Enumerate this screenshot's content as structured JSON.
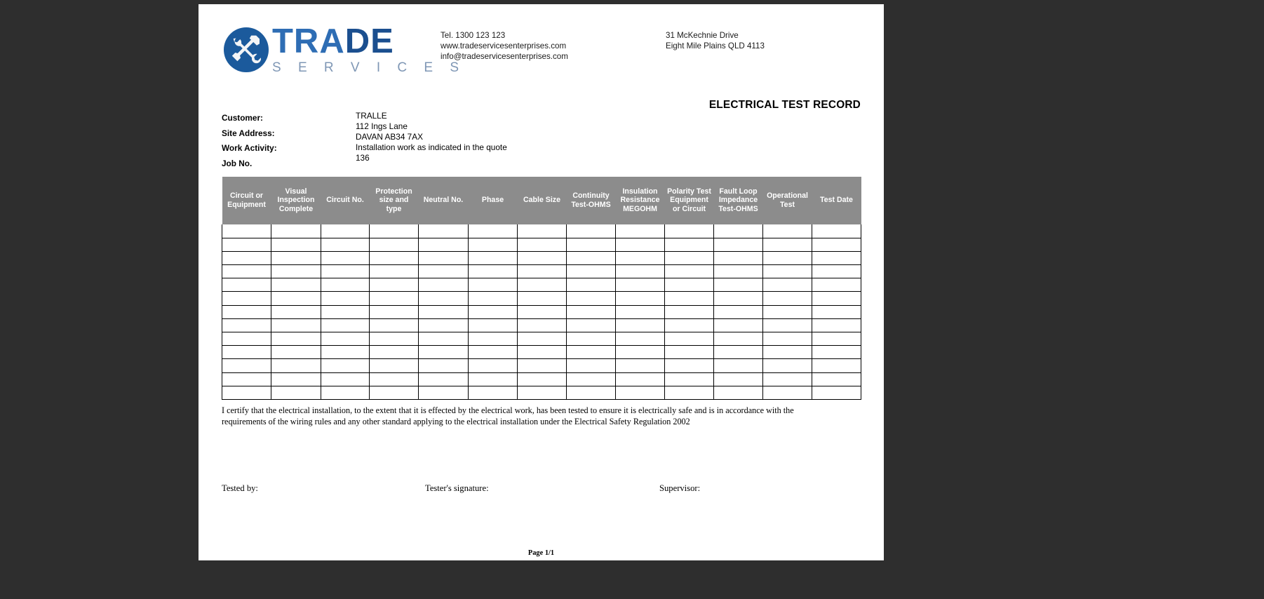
{
  "document": {
    "title": "ELECTRICAL TEST RECORD",
    "footer_page_label": "Page 1/1"
  },
  "letterhead": {
    "logo": {
      "mark_icon": "crossed-hammer-wrench-circle-icon",
      "word_main": "TRADE",
      "word_sub": "S E R V I C E S",
      "brand_blue": "#2e6db4",
      "brand_blue_dark": "#1b4f8f",
      "brand_grey_blue": "#7f97b5"
    },
    "contact": {
      "tel": "Tel. 1300 123 123",
      "website": "www.tradeservicesenterprises.com",
      "email": "info@tradeservicesenterprises.com"
    },
    "address": {
      "line1": "31 McKechnie Drive",
      "line2": "Eight Mile Plains QLD 4113"
    }
  },
  "info": {
    "labels": {
      "customer": "Customer:",
      "site_address": "Site Address:",
      "work_activity": "Work Activity:",
      "job_no": "Job No."
    },
    "values": {
      "customer": "TRALLE",
      "site_address_line1": "112  Ings Lane",
      "site_address_line2": "DAVAN  AB34 7AX",
      "work_activity": "Installation work as indicated in the quote",
      "job_no": "136"
    }
  },
  "test_table": {
    "header_bg": "#8c8c8c",
    "header_color": "#ffffff",
    "columns": [
      "Circuit or Equipment",
      "Visual Inspection Complete",
      "Circuit No.",
      "Protection size and type",
      "Neutral No.",
      "Phase",
      "Cable Size",
      "Continuity Test-OHMS",
      "Insulation Resistance MEGOHM",
      "Polarity Test Equipment or Circuit",
      "Fault Loop Impedance Test-OHMS",
      "Operational Test",
      "Test Date"
    ],
    "row_count": 13,
    "rows": [
      [
        "",
        "",
        "",
        "",
        "",
        "",
        "",
        "",
        "",
        "",
        "",
        "",
        ""
      ],
      [
        "",
        "",
        "",
        "",
        "",
        "",
        "",
        "",
        "",
        "",
        "",
        "",
        ""
      ],
      [
        "",
        "",
        "",
        "",
        "",
        "",
        "",
        "",
        "",
        "",
        "",
        "",
        ""
      ],
      [
        "",
        "",
        "",
        "",
        "",
        "",
        "",
        "",
        "",
        "",
        "",
        "",
        ""
      ],
      [
        "",
        "",
        "",
        "",
        "",
        "",
        "",
        "",
        "",
        "",
        "",
        "",
        ""
      ],
      [
        "",
        "",
        "",
        "",
        "",
        "",
        "",
        "",
        "",
        "",
        "",
        "",
        ""
      ],
      [
        "",
        "",
        "",
        "",
        "",
        "",
        "",
        "",
        "",
        "",
        "",
        "",
        ""
      ],
      [
        "",
        "",
        "",
        "",
        "",
        "",
        "",
        "",
        "",
        "",
        "",
        "",
        ""
      ],
      [
        "",
        "",
        "",
        "",
        "",
        "",
        "",
        "",
        "",
        "",
        "",
        "",
        ""
      ],
      [
        "",
        "",
        "",
        "",
        "",
        "",
        "",
        "",
        "",
        "",
        "",
        "",
        ""
      ],
      [
        "",
        "",
        "",
        "",
        "",
        "",
        "",
        "",
        "",
        "",
        "",
        "",
        ""
      ],
      [
        "",
        "",
        "",
        "",
        "",
        "",
        "",
        "",
        "",
        "",
        "",
        "",
        ""
      ],
      [
        "",
        "",
        "",
        "",
        "",
        "",
        "",
        "",
        "",
        "",
        "",
        "",
        ""
      ]
    ]
  },
  "certification": {
    "line1": "I certify that the electrical installation, to the extent that it is effected by the electrical work, has been tested to ensure it is electrically safe and is in accordance with the",
    "line2": "requirements of the wiring rules and any other standard applying to the electrical installation under the Electrical Safety Regulation 2002"
  },
  "signatures": {
    "tested_by": "Tested by:",
    "tester_signature": "Tester's signature:",
    "supervisor": "Supervisor:"
  }
}
